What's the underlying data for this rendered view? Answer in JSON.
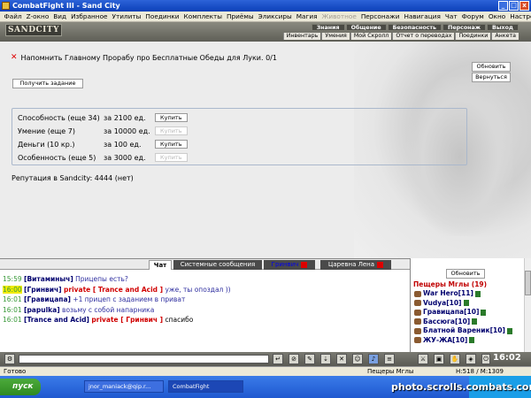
{
  "window": {
    "title": "CombatFight III - Sand City",
    "min": "_",
    "max": "□",
    "close": "x"
  },
  "menu": [
    "Файл",
    "Z-окно",
    "Вид",
    "Избранное",
    "Утилиты",
    "Поединки",
    "Комплекты",
    "Приёмы",
    "Эликсиры",
    "Магия",
    "Животное",
    "Персонажи",
    "Навигация",
    "Чат",
    "Форум",
    "Окно",
    "Настройки",
    "?"
  ],
  "game": {
    "logo": "SANDCITY",
    "nav_top": [
      "Знания",
      "Общение",
      "Безопасность",
      "Персонаж",
      "Выход"
    ],
    "nav_bottom": [
      "Инвентарь",
      "Умения",
      "Мой Скролл",
      "Отчет о переводах",
      "Поединки",
      "Анкета"
    ]
  },
  "quest": {
    "text": "Напомнить Главному Прорабу про Бесплатные Обеды для Луки. 0/1",
    "get_task": "Получить задание",
    "refresh": "Обновить",
    "back": "Вернуться"
  },
  "shop": {
    "rows": [
      {
        "name": "Способность (еще 34)",
        "price": "за 2100 ед.",
        "button": "Купить",
        "enabled": true
      },
      {
        "name": "Умение (еще 7)",
        "price": "за 10000 ед.",
        "button": "Купить",
        "enabled": false
      },
      {
        "name": "Деньги (10 кр.)",
        "price": "за 100 ед.",
        "button": "Купить",
        "enabled": true
      },
      {
        "name": "Особенность (еще 5)",
        "price": "за 3000 ед.",
        "button": "Купить",
        "enabled": false
      }
    ]
  },
  "reputation": "Репутация в Sandcity: 4444 (нет)",
  "chat": {
    "tabs": [
      "Чат",
      "Системные сообщения",
      "Гринвич",
      "Царевна Лена"
    ],
    "messages": [
      {
        "time": "15:59",
        "name": "[Витаминыч]",
        "private": "",
        "text": "Прицепы есть?"
      },
      {
        "time": "16:00",
        "name": "[Гринвич]",
        "private": "private [ Trance and Acid ]",
        "text": "уже, ты опоздал ))"
      },
      {
        "time": "16:01",
        "name": "[Гравицапа]",
        "private": "",
        "text": "+1 прицеп с заданием в приват"
      },
      {
        "time": "16:01",
        "name": "[papulka]",
        "private": "",
        "text": "возьму с собой напарника"
      },
      {
        "time": "16:01",
        "name": "[Trance and Acid]",
        "private": "private [ Гринвич ]",
        "text": "спасибо"
      }
    ]
  },
  "players": {
    "refresh": "Обновить",
    "location": "Пещеры Мглы (19)",
    "list": [
      "War Hero[11]",
      "Vudya[10]",
      "Гравицапа[10]",
      "Бассюга[10]",
      "Блатной Вареник[10]",
      "ЖУ-ЖА[10]"
    ]
  },
  "clock": "16:02",
  "status": {
    "left": "Готово",
    "location": "Пещеры Мглы",
    "hp": "H:518 / M:1309"
  },
  "taskbar": {
    "start": "пуск",
    "items": [
      "jnor_maniack@qip.r...",
      "CombatFight"
    ]
  },
  "watermark": "photo.scrolls.combats.com"
}
